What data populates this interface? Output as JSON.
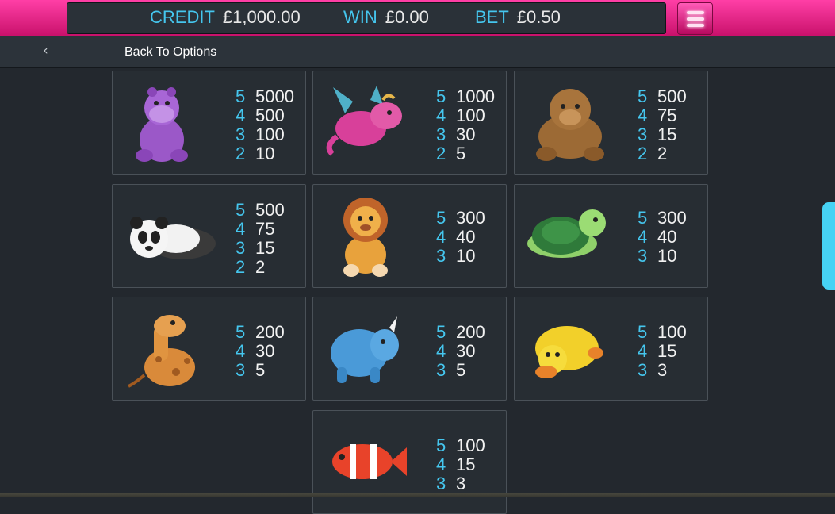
{
  "meters": {
    "credit_label": "CREDIT",
    "credit_value": "£1,000.00",
    "win_label": "WIN",
    "win_value": "£0.00",
    "bet_label": "BET",
    "bet_value": "£0.50"
  },
  "nav": {
    "back_label": "Back To Options"
  },
  "symbols": [
    {
      "name": "purple-hippo",
      "pays": [
        {
          "count": "5",
          "amount": "5000"
        },
        {
          "count": "4",
          "amount": "500"
        },
        {
          "count": "3",
          "amount": "100"
        },
        {
          "count": "2",
          "amount": "10"
        }
      ]
    },
    {
      "name": "pink-dragon",
      "pays": [
        {
          "count": "5",
          "amount": "1000"
        },
        {
          "count": "4",
          "amount": "100"
        },
        {
          "count": "3",
          "amount": "30"
        },
        {
          "count": "2",
          "amount": "5"
        }
      ]
    },
    {
      "name": "brown-monkey",
      "pays": [
        {
          "count": "5",
          "amount": "500"
        },
        {
          "count": "4",
          "amount": "75"
        },
        {
          "count": "3",
          "amount": "15"
        },
        {
          "count": "2",
          "amount": "2"
        }
      ]
    },
    {
      "name": "panda",
      "pays": [
        {
          "count": "5",
          "amount": "500"
        },
        {
          "count": "4",
          "amount": "75"
        },
        {
          "count": "3",
          "amount": "15"
        },
        {
          "count": "2",
          "amount": "2"
        }
      ]
    },
    {
      "name": "lion",
      "pays": [
        {
          "count": "5",
          "amount": "300"
        },
        {
          "count": "4",
          "amount": "40"
        },
        {
          "count": "3",
          "amount": "10"
        }
      ]
    },
    {
      "name": "turtle",
      "pays": [
        {
          "count": "5",
          "amount": "300"
        },
        {
          "count": "4",
          "amount": "40"
        },
        {
          "count": "3",
          "amount": "10"
        }
      ]
    },
    {
      "name": "giraffe",
      "pays": [
        {
          "count": "5",
          "amount": "200"
        },
        {
          "count": "4",
          "amount": "30"
        },
        {
          "count": "3",
          "amount": "5"
        }
      ]
    },
    {
      "name": "blue-rhino",
      "pays": [
        {
          "count": "5",
          "amount": "200"
        },
        {
          "count": "4",
          "amount": "30"
        },
        {
          "count": "3",
          "amount": "5"
        }
      ]
    },
    {
      "name": "yellow-duck",
      "pays": [
        {
          "count": "5",
          "amount": "100"
        },
        {
          "count": "4",
          "amount": "15"
        },
        {
          "count": "3",
          "amount": "3"
        }
      ]
    },
    {
      "name": "clownfish",
      "pays": [
        {
          "count": "5",
          "amount": "100"
        },
        {
          "count": "4",
          "amount": "15"
        },
        {
          "count": "3",
          "amount": "3"
        }
      ]
    }
  ],
  "colors": {
    "accent": "#ff3fa6",
    "count_color": "#45c6ee",
    "scrollbar": "#46d3f4"
  },
  "icons": {
    "menu": "hamburger-menu-icon",
    "back": "chevron-left-icon"
  }
}
